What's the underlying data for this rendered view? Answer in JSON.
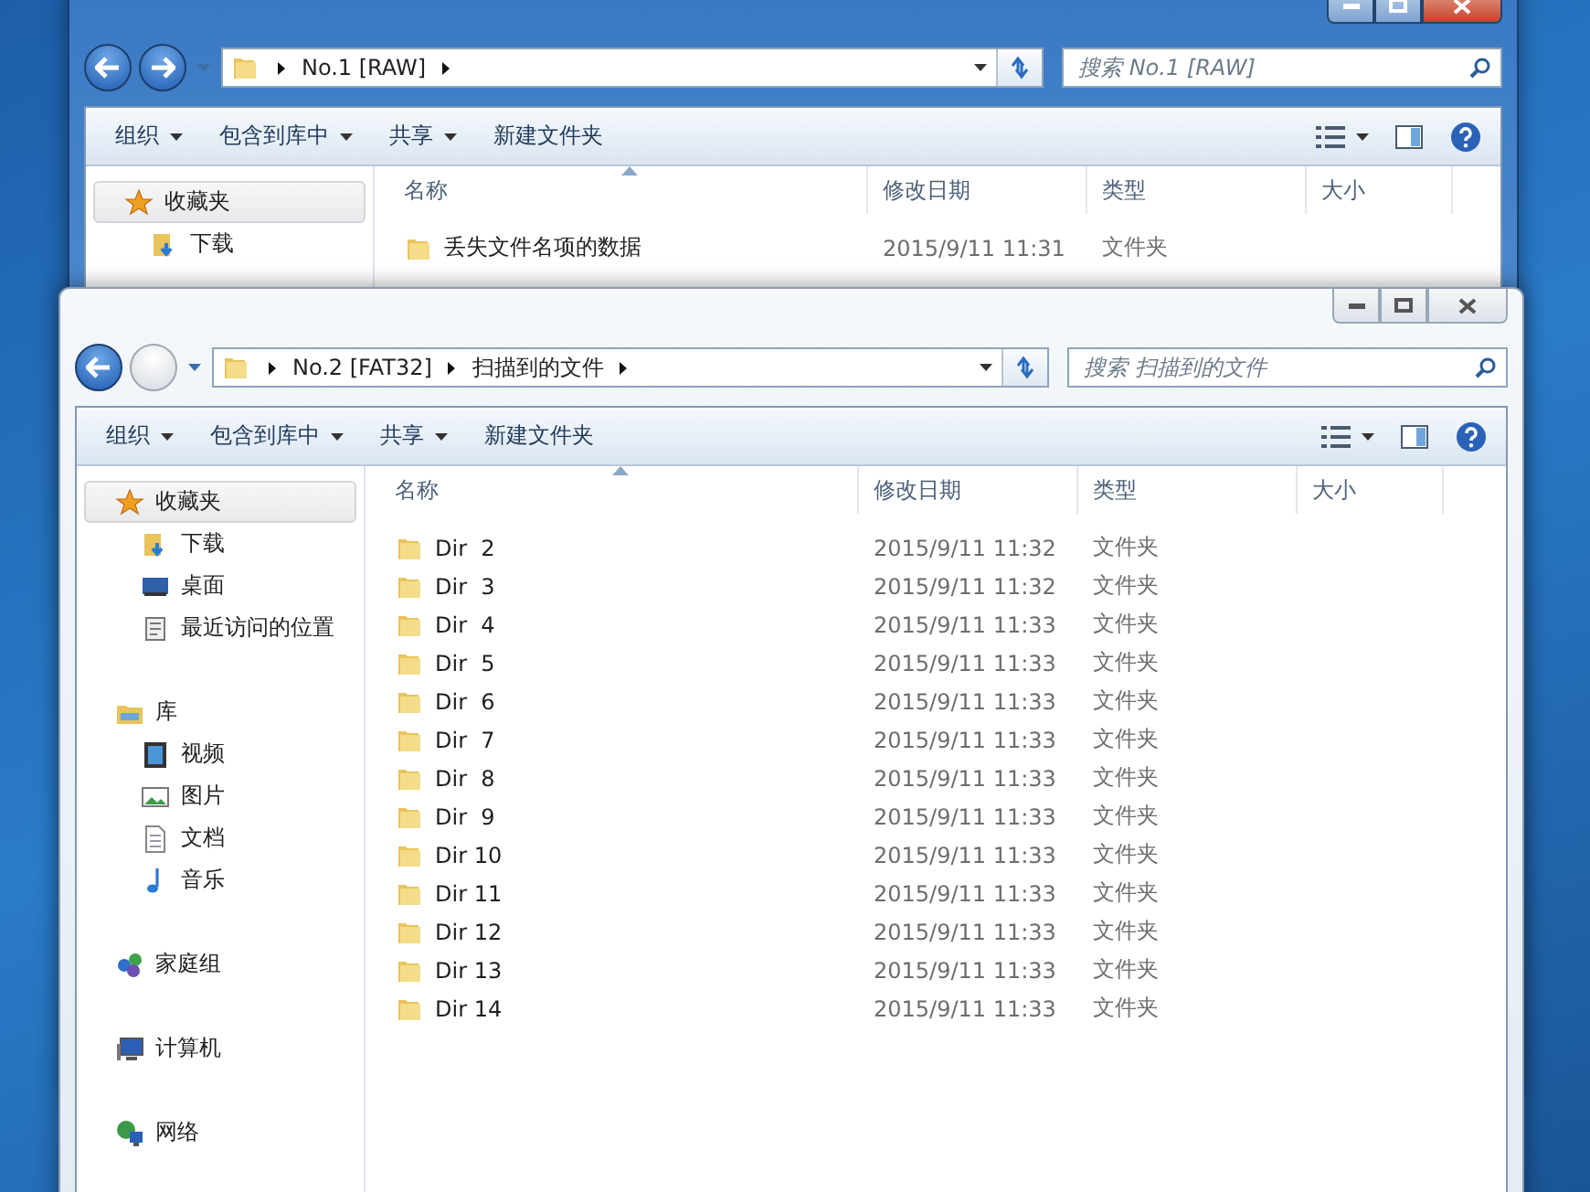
{
  "windows": [
    {
      "active": true,
      "forward_enabled": true,
      "path": [
        "No.1 [RAW]"
      ],
      "search": {
        "placeholder": "搜索 No.1 [RAW]"
      },
      "toolbar": [
        {
          "label": "组织",
          "dropdown": true
        },
        {
          "label": "包含到库中",
          "dropdown": true
        },
        {
          "label": "共享",
          "dropdown": true
        },
        {
          "label": "新建文件夹",
          "dropdown": false
        }
      ],
      "sidebar": [
        {
          "label": "收藏夹",
          "kind": "favorites",
          "selected": true,
          "children": [
            {
              "label": "下载",
              "kind": "downloads"
            }
          ]
        }
      ],
      "columns": [
        {
          "label": "名称",
          "sorted": true
        },
        {
          "label": "修改日期",
          "sorted": false
        },
        {
          "label": "类型",
          "sorted": false
        },
        {
          "label": "大小",
          "sorted": false
        }
      ],
      "rows": [
        {
          "name": "丢失文件名项的数据",
          "modified": "2015/9/11 11:31",
          "type": "文件夹"
        }
      ]
    },
    {
      "active": false,
      "forward_enabled": false,
      "path": [
        "No.2 [FAT32]",
        "扫描到的文件"
      ],
      "search": {
        "placeholder": "搜索 扫描到的文件"
      },
      "toolbar": [
        {
          "label": "组织",
          "dropdown": true
        },
        {
          "label": "包含到库中",
          "dropdown": true
        },
        {
          "label": "共享",
          "dropdown": true
        },
        {
          "label": "新建文件夹",
          "dropdown": false
        }
      ],
      "sidebar": [
        {
          "label": "收藏夹",
          "kind": "favorites",
          "selected": true,
          "children": [
            {
              "label": "下载",
              "kind": "downloads"
            },
            {
              "label": "桌面",
              "kind": "desktop"
            },
            {
              "label": "最近访问的位置",
              "kind": "recent"
            }
          ]
        },
        {
          "label": "库",
          "kind": "library",
          "selected": false,
          "children": [
            {
              "label": "视频",
              "kind": "video"
            },
            {
              "label": "图片",
              "kind": "pictures"
            },
            {
              "label": "文档",
              "kind": "documents"
            },
            {
              "label": "音乐",
              "kind": "music"
            }
          ]
        },
        {
          "label": "家庭组",
          "kind": "homegroup",
          "selected": false
        },
        {
          "label": "计算机",
          "kind": "computer",
          "selected": false
        },
        {
          "label": "网络",
          "kind": "network",
          "selected": false
        }
      ],
      "columns": [
        {
          "label": "名称",
          "sorted": true
        },
        {
          "label": "修改日期",
          "sorted": false
        },
        {
          "label": "类型",
          "sorted": false
        },
        {
          "label": "大小",
          "sorted": false
        }
      ],
      "rows": [
        {
          "name": "Dir  2",
          "modified": "2015/9/11 11:32",
          "type": "文件夹"
        },
        {
          "name": "Dir  3",
          "modified": "2015/9/11 11:32",
          "type": "文件夹"
        },
        {
          "name": "Dir  4",
          "modified": "2015/9/11 11:33",
          "type": "文件夹"
        },
        {
          "name": "Dir  5",
          "modified": "2015/9/11 11:33",
          "type": "文件夹"
        },
        {
          "name": "Dir  6",
          "modified": "2015/9/11 11:33",
          "type": "文件夹"
        },
        {
          "name": "Dir  7",
          "modified": "2015/9/11 11:33",
          "type": "文件夹"
        },
        {
          "name": "Dir  8",
          "modified": "2015/9/11 11:33",
          "type": "文件夹"
        },
        {
          "name": "Dir  9",
          "modified": "2015/9/11 11:33",
          "type": "文件夹"
        },
        {
          "name": "Dir 10",
          "modified": "2015/9/11 11:33",
          "type": "文件夹"
        },
        {
          "name": "Dir 11",
          "modified": "2015/9/11 11:33",
          "type": "文件夹"
        },
        {
          "name": "Dir 12",
          "modified": "2015/9/11 11:33",
          "type": "文件夹"
        },
        {
          "name": "Dir 13",
          "modified": "2015/9/11 11:33",
          "type": "文件夹"
        },
        {
          "name": "Dir 14",
          "modified": "2015/9/11 11:33",
          "type": "文件夹"
        }
      ]
    }
  ]
}
